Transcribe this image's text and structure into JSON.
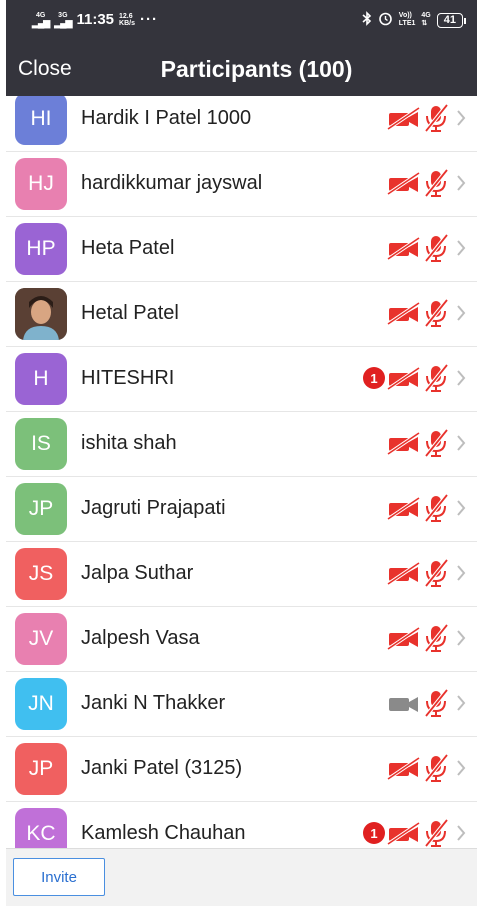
{
  "status_bar": {
    "sim1": "4G",
    "sim2": "3G",
    "time": "11:35",
    "speed_value": "12.6",
    "speed_unit": "KB/s",
    "overflow": "···",
    "volte_top": "Vo))",
    "volte_bottom": "LTE1",
    "net_type": "4G",
    "battery": "41"
  },
  "header": {
    "close_label": "Close",
    "title": "Participants (100)"
  },
  "participants": [
    {
      "initials": "HI",
      "name": "Hardik I Patel 1000",
      "avatar_color": "#6c7fd8",
      "video": "off",
      "audio": "muted",
      "badge": ""
    },
    {
      "initials": "HJ",
      "name": "hardikkumar jayswal",
      "avatar_color": "#e880b0",
      "video": "off",
      "audio": "muted",
      "badge": ""
    },
    {
      "initials": "HP",
      "name": "Heta Patel",
      "avatar_color": "#9a64d4",
      "video": "off",
      "audio": "muted",
      "badge": ""
    },
    {
      "initials": "",
      "name": "Hetal Patel",
      "avatar_color": "photo",
      "video": "off",
      "audio": "muted",
      "badge": ""
    },
    {
      "initials": "H",
      "name": "HITESHRI",
      "avatar_color": "#9a64d4",
      "video": "off",
      "audio": "muted",
      "badge": "1"
    },
    {
      "initials": "IS",
      "name": "ishita shah",
      "avatar_color": "#7cc07a",
      "video": "off",
      "audio": "muted",
      "badge": ""
    },
    {
      "initials": "JP",
      "name": "Jagruti Prajapati",
      "avatar_color": "#7cc07a",
      "video": "off",
      "audio": "muted",
      "badge": ""
    },
    {
      "initials": "JS",
      "name": "Jalpa Suthar",
      "avatar_color": "#f06060",
      "video": "off",
      "audio": "muted",
      "badge": ""
    },
    {
      "initials": "JV",
      "name": "Jalpesh Vasa",
      "avatar_color": "#e880b0",
      "video": "off",
      "audio": "muted",
      "badge": ""
    },
    {
      "initials": "JN",
      "name": "Janki N Thakker",
      "avatar_color": "#40bff0",
      "video": "on",
      "audio": "muted",
      "badge": ""
    },
    {
      "initials": "JP",
      "name": "Janki Patel (3125)",
      "avatar_color": "#f06060",
      "video": "off",
      "audio": "muted",
      "badge": ""
    },
    {
      "initials": "KC",
      "name": "Kamlesh Chauhan",
      "avatar_color": "#c070d8",
      "video": "off",
      "audio": "muted",
      "badge": "1"
    }
  ],
  "icons": {
    "video_off": "video-off-icon",
    "video_on": "video-on-icon",
    "mic_muted": "mic-muted-icon",
    "chevron": "chevron-right-icon"
  },
  "colors": {
    "header_bg": "#34343c",
    "muted_red": "#e8322c",
    "video_gray": "#8a8a8a",
    "chevron_gray": "#bdbdbd",
    "invite_blue": "#2a6fd0"
  },
  "footer": {
    "invite_label": "Invite"
  }
}
